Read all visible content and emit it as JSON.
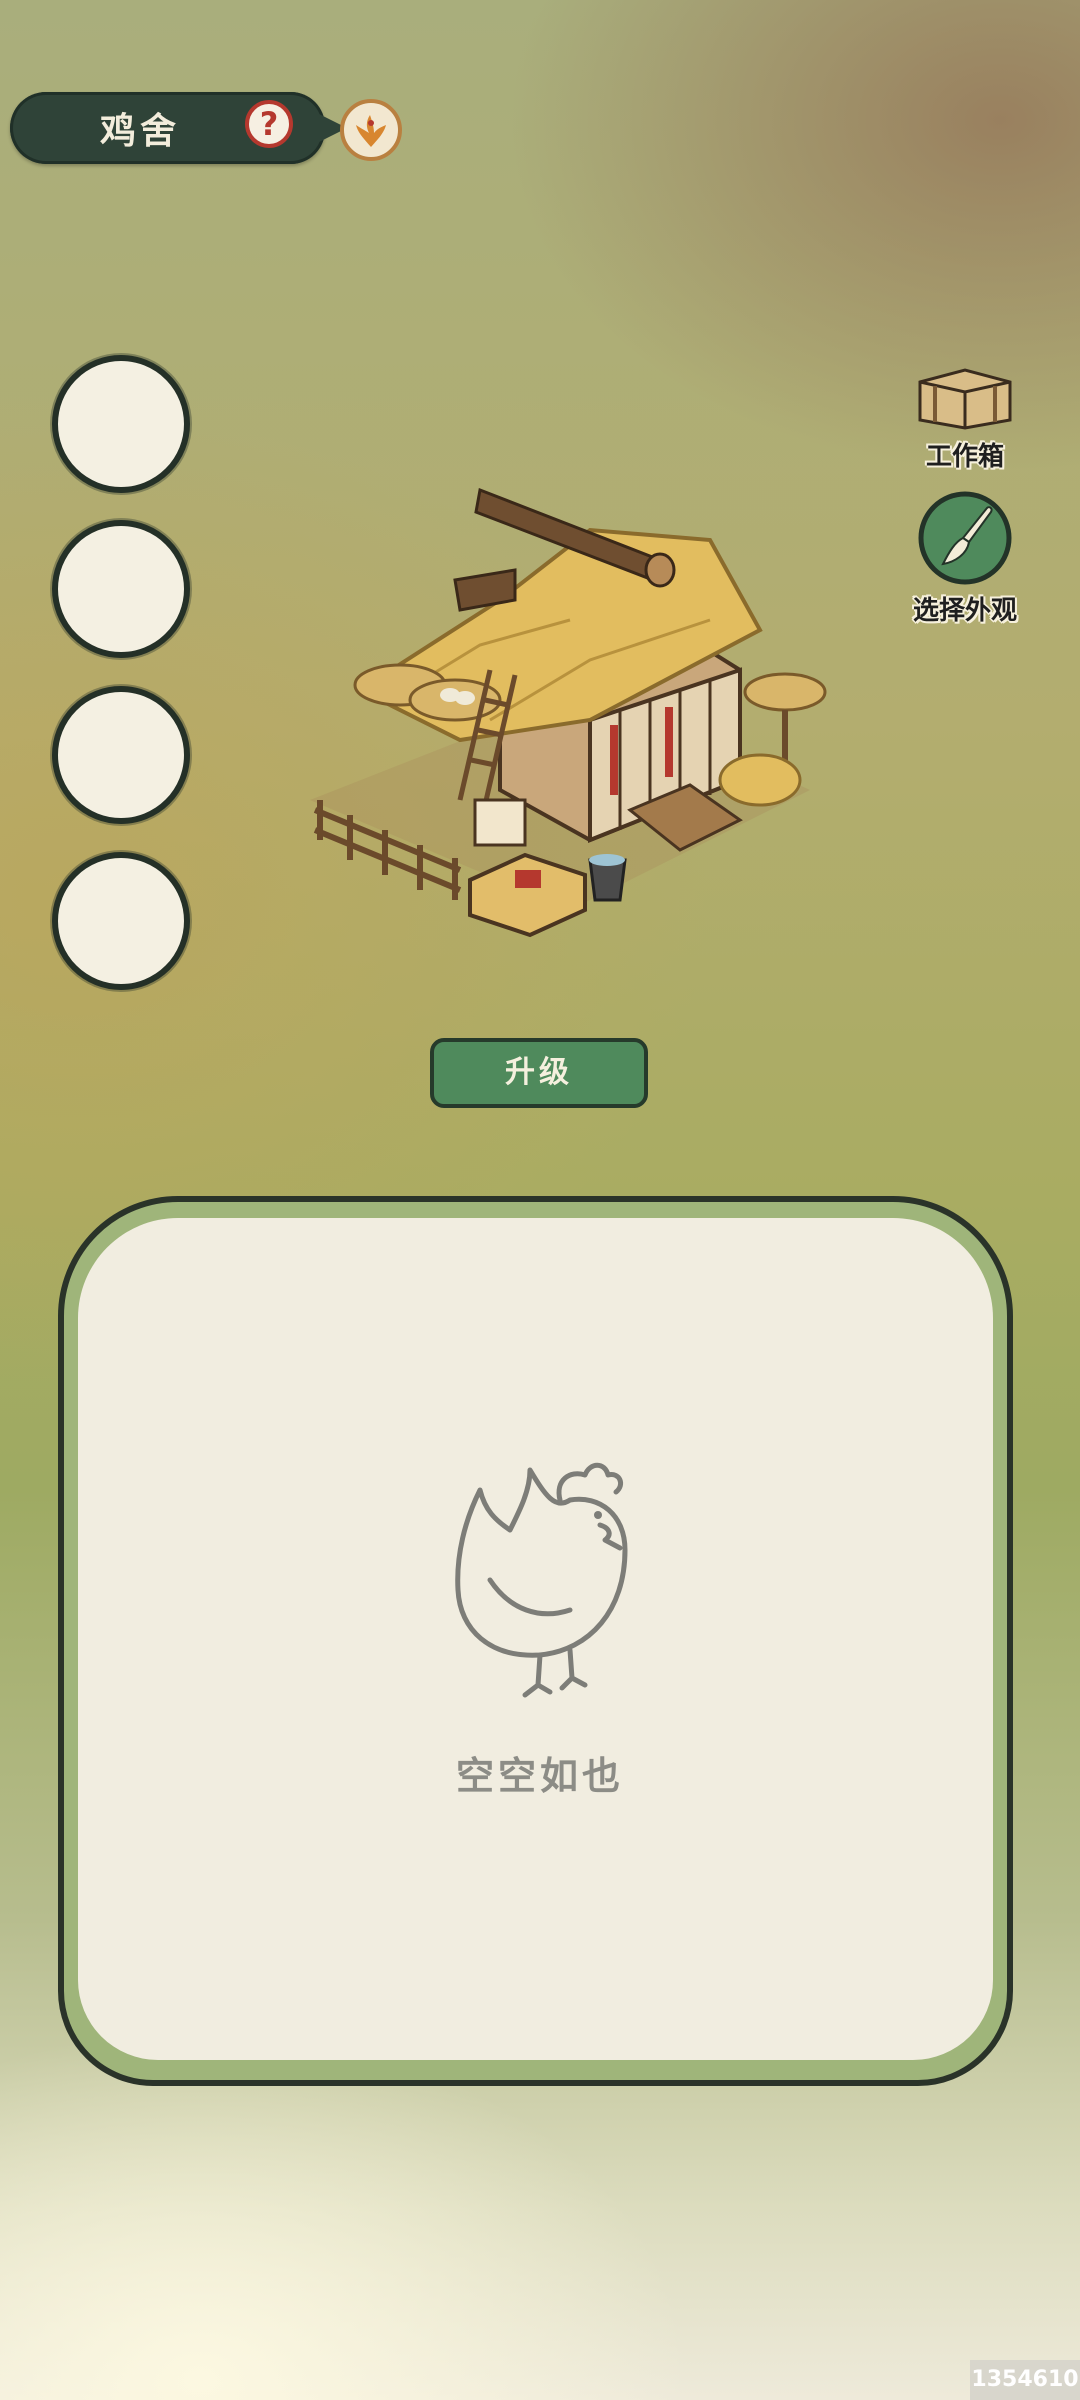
{
  "header": {
    "title": "鸡舍",
    "help_symbol": "?",
    "help_icon": "question-mark-icon",
    "appearance_icon": "phoenix-icon"
  },
  "slots": [
    {
      "name": "slot-1",
      "content": ""
    },
    {
      "name": "slot-2",
      "content": ""
    },
    {
      "name": "slot-3",
      "content": ""
    },
    {
      "name": "slot-4",
      "content": ""
    }
  ],
  "building": {
    "name_icon": "chicken-coop-illustration"
  },
  "tools": {
    "workbox": {
      "label": "工作箱",
      "icon": "chest-icon"
    },
    "appearance": {
      "label": "选择外观",
      "icon": "brush-icon"
    }
  },
  "actions": {
    "upgrade_label": "升级"
  },
  "panel": {
    "empty_text": "空空如也",
    "placeholder_icon": "chicken-outline-icon"
  },
  "footer": {
    "id_badge": "1354610"
  },
  "colors": {
    "dark_green": "#2f4338",
    "button_green": "#4f8a5c",
    "panel_border": "#9fb57a",
    "paper": "#f1ede0",
    "help_red": "#b5382e"
  }
}
